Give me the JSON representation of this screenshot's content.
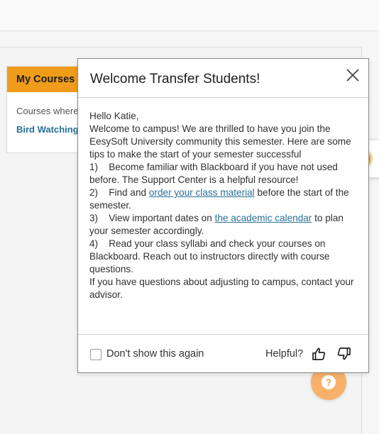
{
  "courses_card": {
    "header": "My Courses",
    "subtitle": "Courses where",
    "course_link": "Bird Watching"
  },
  "modal": {
    "title": "Welcome Transfer Students!",
    "greeting": "Hello Katie,",
    "intro": "Welcome to campus! We are thrilled to have you join the EesySoft University community this semester. Here are some tips to make the start of your semester successful",
    "tip1": "1)    Become familiar with Blackboard if you have not used before. The Support Center is a helpful resource!",
    "tip2_before": "2)    Find and ",
    "tip2_link": "order your class material",
    "tip2_after": " before the start of the semester.",
    "tip3_before": "3)    View important dates on ",
    "tip3_link": "the academic calendar",
    "tip3_after": " to plan your semester accordingly.",
    "tip4": "4)    Read your class syllabi and check your courses on Blackboard. Reach out to instructors directly with course questions.",
    "closing": "If you have questions about adjusting to campus, contact your advisor.",
    "dont_show_label": "Don't show this again",
    "dont_show_checked": false,
    "helpful_label": "Helpful?"
  },
  "icons": {
    "close": "close-icon",
    "thumbs_up": "thumbs-up-icon",
    "thumbs_down": "thumbs-down-icon",
    "side_widget": "eesysoft-coin-icon",
    "help": "question-mark-icon"
  },
  "side_widget": {
    "glyph": "e"
  },
  "help_button": {
    "glyph": "?"
  },
  "colors": {
    "accent_orange": "#f09c1b",
    "link_blue": "#2a6f97",
    "help_fab": "#f7b16a"
  }
}
